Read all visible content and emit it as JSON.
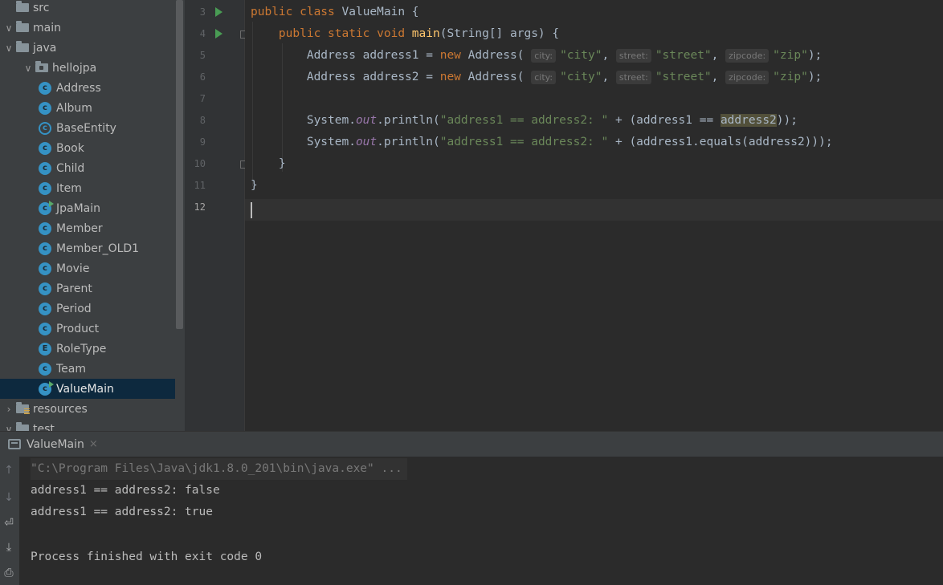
{
  "project_tree": {
    "items": [
      {
        "label": "src",
        "kind": "folder",
        "indent": 0,
        "chevron": ""
      },
      {
        "label": "main",
        "kind": "folder",
        "indent": 0,
        "chevron": "∨"
      },
      {
        "label": "java",
        "kind": "folder",
        "indent": 1,
        "chevron": "∨"
      },
      {
        "label": "hellojpa",
        "kind": "package",
        "indent": 2,
        "chevron": "∨"
      },
      {
        "label": "Address",
        "kind": "class",
        "indent": 3
      },
      {
        "label": "Album",
        "kind": "class",
        "indent": 3
      },
      {
        "label": "BaseEntity",
        "kind": "abstract",
        "indent": 3
      },
      {
        "label": "Book",
        "kind": "class",
        "indent": 3
      },
      {
        "label": "Child",
        "kind": "class",
        "indent": 3
      },
      {
        "label": "Item",
        "kind": "class",
        "indent": 3
      },
      {
        "label": "JpaMain",
        "kind": "main",
        "indent": 3
      },
      {
        "label": "Member",
        "kind": "class",
        "indent": 3
      },
      {
        "label": "Member_OLD1",
        "kind": "class",
        "indent": 3
      },
      {
        "label": "Movie",
        "kind": "class",
        "indent": 3
      },
      {
        "label": "Parent",
        "kind": "class",
        "indent": 3
      },
      {
        "label": "Period",
        "kind": "class",
        "indent": 3
      },
      {
        "label": "Product",
        "kind": "class",
        "indent": 3
      },
      {
        "label": "RoleType",
        "kind": "enum",
        "indent": 3
      },
      {
        "label": "Team",
        "kind": "class",
        "indent": 3
      },
      {
        "label": "ValueMain",
        "kind": "main",
        "indent": 3,
        "selected": true
      },
      {
        "label": "resources",
        "kind": "resources",
        "indent": 1,
        "chevron": "›"
      },
      {
        "label": "test",
        "kind": "folder",
        "indent": 0,
        "chevron": "∨"
      }
    ]
  },
  "editor": {
    "current_line": "12",
    "lines": [
      {
        "no": "3",
        "run": true
      },
      {
        "no": "4",
        "run": true
      },
      {
        "no": "5"
      },
      {
        "no": "6"
      },
      {
        "no": "7"
      },
      {
        "no": "8"
      },
      {
        "no": "9"
      },
      {
        "no": "10"
      },
      {
        "no": "11"
      },
      {
        "no": "12"
      }
    ],
    "code": {
      "l3": {
        "kw": "public class ",
        "name": "ValueMain",
        "brace": " {"
      },
      "l4": {
        "kw": "public static void ",
        "fn": "main",
        "rest": "(String[] args) {"
      },
      "l5": {
        "decl": "Address address1 = ",
        "kw": "new ",
        "ctor": "Address(",
        "h1": "city:",
        "s1": "\"city\"",
        "h2": "street:",
        "s2": "\"street\"",
        "h3": "zipcode:",
        "s3": "\"zip\"",
        "end": ");"
      },
      "l6": {
        "decl": "Address address2 = ",
        "kw": "new ",
        "ctor": "Address(",
        "h1": "city:",
        "s1": "\"city\"",
        "h2": "street:",
        "s2": "\"street\"",
        "h3": "zipcode:",
        "s3": "\"zip\"",
        "end": ");"
      },
      "l8": {
        "pre": "System.",
        "fld": "out",
        "call": ".println(",
        "str": "\"address1 == address2: \"",
        "mid": " + (address1 == ",
        "hl": "address2",
        "end": "));"
      },
      "l9": {
        "pre": "System.",
        "fld": "out",
        "call": ".println(",
        "str": "\"address1 == address2: \"",
        "mid": " + (address1.equals(address2)));"
      },
      "l10": "}",
      "l11": "}"
    }
  },
  "run_panel": {
    "tab_label": "ValueMain",
    "tab_close": "×",
    "output": [
      "\"C:\\Program Files\\Java\\jdk1.8.0_201\\bin\\java.exe\" ...",
      "address1 == address2: false",
      "address1 == address2: true",
      "",
      "Process finished with exit code 0"
    ]
  }
}
